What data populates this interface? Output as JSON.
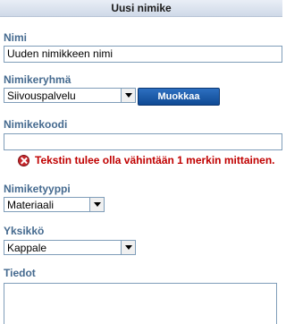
{
  "header": {
    "title": "Uusi nimike"
  },
  "fields": {
    "nimi": {
      "label": "Nimi",
      "value": "Uuden nimikkeen nimi"
    },
    "nimikeryhma": {
      "label": "Nimikeryhmä",
      "value": "Siivouspalvelu",
      "edit_button": "Muokkaa"
    },
    "nimikekoodi": {
      "label": "Nimikekoodi",
      "value": ""
    },
    "error": {
      "text": "Tekstin tulee olla vähintään 1 merkin mittainen."
    },
    "nimiketyyppi": {
      "label": "Nimiketyyppi",
      "value": "Materiaali"
    },
    "yksikko": {
      "label": "Yksikkö",
      "value": "Kappale"
    },
    "tiedot": {
      "label": "Tiedot",
      "value": ""
    }
  },
  "colors": {
    "label": "#456a8f",
    "error": "#c00000",
    "button": "#1a5aa8"
  },
  "icons": {
    "error": "error-x-icon",
    "dropdown": "chevron-down-icon"
  }
}
